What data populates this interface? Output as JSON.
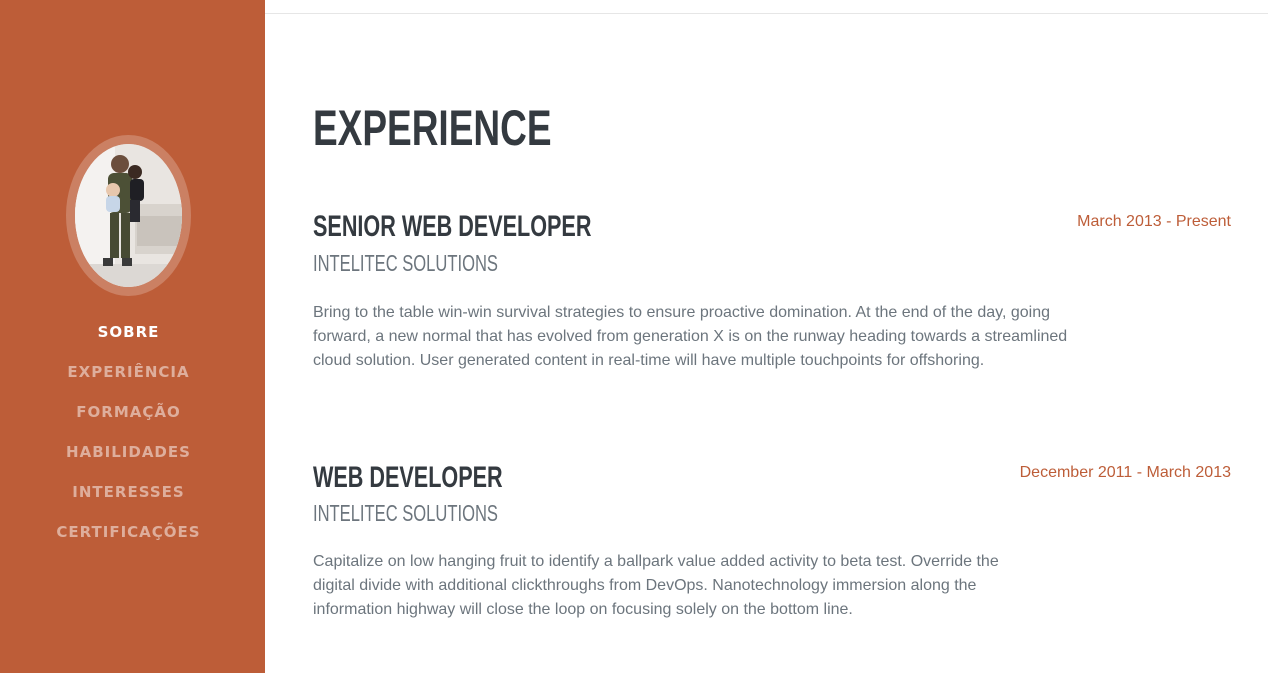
{
  "sidebar": {
    "nav": [
      {
        "label": "SOBRE",
        "active": true
      },
      {
        "label": "EXPERIÊNCIA",
        "active": false
      },
      {
        "label": "FORMAÇÃO",
        "active": false
      },
      {
        "label": "HABILIDADES",
        "active": false
      },
      {
        "label": "INTERESSES",
        "active": false
      },
      {
        "label": "CERTIFICAÇÕES",
        "active": false
      }
    ],
    "bg_color": "#bd5d38"
  },
  "main": {
    "title": "EXPERIENCE",
    "jobs": [
      {
        "title": "SENIOR WEB DEVELOPER",
        "company": "INTELITEC SOLUTIONS",
        "date": "March 2013 - Present",
        "description": "Bring to the table win-win survival strategies to ensure proactive domination. At the end of the day, going forward, a new normal that has evolved from generation X is on the runway heading towards a streamlined cloud solution. User generated content in real-time will have multiple touchpoints for offshoring."
      },
      {
        "title": "WEB DEVELOPER",
        "company": "INTELITEC SOLUTIONS",
        "date": "December 2011 - March 2013",
        "description": "Capitalize on low hanging fruit to identify a ballpark value added activity to beta test. Override the digital divide with additional clickthroughs from DevOps. Nanotechnology immersion along the information highway will close the loop on focusing solely on the bottom line."
      }
    ]
  },
  "colors": {
    "accent": "#bd5d38",
    "heading": "#343a40",
    "muted": "#6c757d"
  }
}
